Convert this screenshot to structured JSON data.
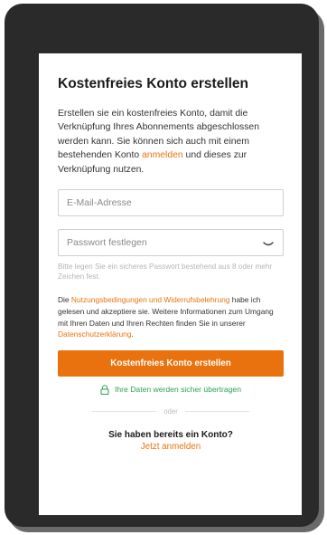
{
  "form": {
    "title": "Kostenfreies Konto erstellen",
    "intro_text": "Erstellen sie ein kostenfreies Konto, damit die Verknüpfung Ihres Abonnements abgeschlossen werden kann. Sie können sich auch mit einem bestehenden Konto ",
    "intro_link": "anmelden",
    "intro_suffix": " und dieses zur Verknüpfung nutzen.",
    "email_placeholder": "E-Mail-Adresse",
    "email_value": "",
    "password_placeholder": "Passwort festlegen",
    "password_value": "",
    "password_hint": "Bitte legen Sie ein sicheres Passwort bestehend aus 8 oder mehr Zeichen fest.",
    "terms_prefix": "Die ",
    "terms_link": "Nutzungsbedingungen und Widerrufsbelehrung",
    "terms_middle": " habe ich gelesen und akzeptiere sie. Weitere Informationen zum Umgang mit Ihren Daten und Ihren Rechten finden Sie in unserer ",
    "privacy_link": "Datenschutzerklärung",
    "terms_suffix": ".",
    "submit_label": "Kostenfreies Konto erstellen",
    "secure_note": "Ihre Daten werden sicher übertragen",
    "divider_label": "oder",
    "login_question": "Sie haben bereits ein Konto?",
    "login_link": "Jetzt anmelden"
  },
  "colors": {
    "accent": "#ea720e",
    "secure_green": "#2e9f55",
    "frame": "#2a2a2a"
  },
  "icons": {
    "password_toggle": "eye-closed-icon",
    "secure": "lock-icon"
  }
}
